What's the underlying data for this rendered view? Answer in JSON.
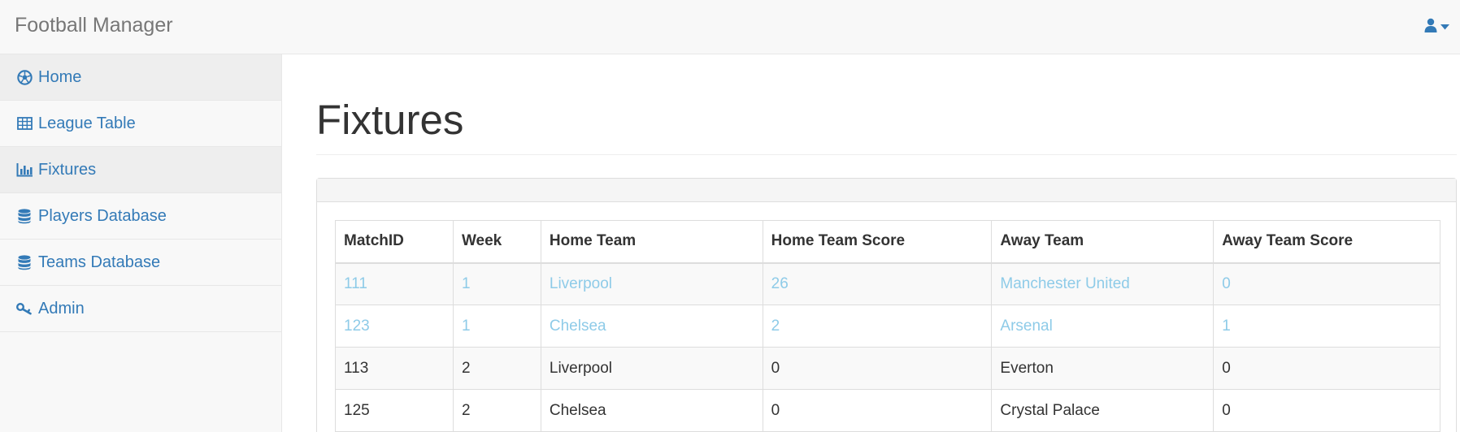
{
  "app": {
    "title": "Football Manager",
    "accent_color": "#337ab7",
    "user_icon": "user-icon",
    "caret_icon": "caret-down-icon"
  },
  "sidebar": {
    "items": [
      {
        "label": "Home",
        "icon": "soccer-ball-icon",
        "active": true
      },
      {
        "label": "League Table",
        "icon": "table-icon",
        "active": false
      },
      {
        "label": "Fixtures",
        "icon": "bar-chart-icon",
        "active": true
      },
      {
        "label": "Players Database",
        "icon": "database-icon",
        "active": false
      },
      {
        "label": "Teams Database",
        "icon": "database-icon",
        "active": false
      },
      {
        "label": "Admin",
        "icon": "key-icon",
        "active": false
      }
    ]
  },
  "main": {
    "page_title": "Fixtures",
    "table": {
      "columns": [
        "MatchID",
        "Week",
        "Home Team",
        "Home Team Score",
        "Away Team",
        "Away Team Score"
      ],
      "rows": [
        [
          "111",
          "1",
          "Liverpool",
          "26",
          "Manchester United",
          "0"
        ],
        [
          "123",
          "1",
          "Chelsea",
          "2",
          "Arsenal",
          "1"
        ],
        [
          "113",
          "2",
          "Liverpool",
          "0",
          "Everton",
          "0"
        ],
        [
          "125",
          "2",
          "Chelsea",
          "0",
          "Crystal Palace",
          "0"
        ]
      ]
    }
  }
}
